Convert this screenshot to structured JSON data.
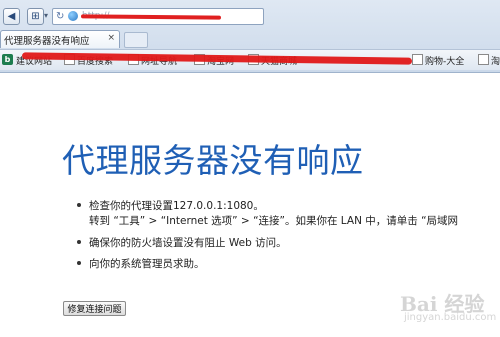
{
  "browser": {
    "url": "http://...",
    "tab": {
      "title": "代理服务器没有响应",
      "close_glyph": "×"
    },
    "nav": {
      "back_icon": "back-icon",
      "home_icon": "home-icon",
      "refresh_icon": "refresh-icon"
    },
    "favorites": {
      "first_label": "建议网站",
      "items": [
        {
          "label": "百度搜索"
        },
        {
          "label": "网址导航"
        },
        {
          "label": "淘宝网"
        },
        {
          "label": "天猫商城"
        },
        {
          "label": "购物-大全"
        },
        {
          "label": "淘"
        }
      ]
    }
  },
  "error_page": {
    "title": "代理服务器没有响应",
    "bullets": [
      {
        "line1": "检查你的代理设置127.0.0.1:1080。",
        "line2": "转到 “工具” > “Internet 选项” > “连接”。如果你在 LAN 中，请单击 “局域网"
      },
      {
        "line1": "确保你的防火墙设置没有阻止 Web 访问。"
      },
      {
        "line1": "向你的系统管理员求助。"
      }
    ],
    "fix_button_label": "修复连接问题"
  },
  "watermark": {
    "main": "Bai 经验",
    "sub": "jingyan.baidu.com"
  },
  "colors": {
    "title_blue": "#1f5fb5",
    "redaction_red": "#e01818"
  }
}
